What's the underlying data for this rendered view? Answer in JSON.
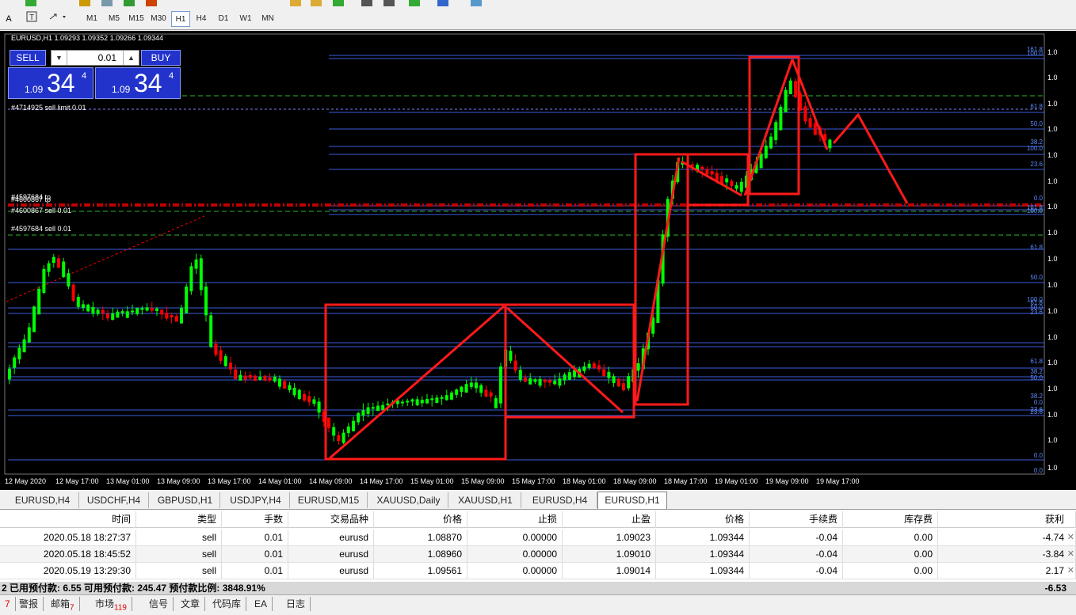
{
  "toolbar": {
    "timeframes": [
      "M1",
      "M5",
      "M15",
      "M30",
      "H1",
      "H4",
      "D1",
      "W1",
      "MN"
    ],
    "active_timeframe": "H1",
    "left_letter": "A"
  },
  "chart": {
    "header": "EURUSD,H1  1.09293 1.09352 1.09266 1.09344",
    "trade_panel": {
      "sell_label": "SELL",
      "buy_label": "BUY",
      "lot": "0.01",
      "sell_price_small": "1.09",
      "sell_price_big": "34",
      "sell_price_sup": "4",
      "buy_price_small": "1.09",
      "buy_price_big": "34",
      "buy_price_sup": "4"
    },
    "order_labels": [
      "#4714925 sell limit 0.01",
      "#4597684 tp",
      "#4600867 tp",
      "#4600867 sell 0.01",
      "#4597684 sell 0.01"
    ],
    "x_labels": [
      "12 May 2020",
      "12 May 17:00",
      "13 May 01:00",
      "13 May 09:00",
      "13 May 17:00",
      "14 May 01:00",
      "14 May 09:00",
      "14 May 17:00",
      "15 May 01:00",
      "15 May 09:00",
      "15 May 17:00",
      "18 May 01:00",
      "18 May 09:00",
      "18 May 17:00",
      "19 May 01:00",
      "19 May 09:00",
      "19 May 17:00"
    ],
    "right_label": "1.0",
    "fib_labels": [
      "161.8",
      "100.0",
      "61.8",
      "50.0",
      "38.2",
      "100.0",
      "23.6",
      "0.0",
      "161.8",
      "100.0",
      "61.8",
      "50.0",
      "100.0",
      "61.8",
      "50.0",
      "23.6",
      "61.8",
      "38.2",
      "50.0",
      "38.2",
      "0.0",
      "23.6",
      "23.6",
      "0.0",
      "0.0"
    ],
    "colors": {
      "background": "#000000",
      "bull": "#00ff00",
      "bear": "#ff0000",
      "annotation": "#ff1a1a",
      "fib_line": "#3b5bdb",
      "level_green": "#2db82d"
    }
  },
  "symbol_tabs": [
    "EURUSD,H4",
    "USDCHF,H4",
    "GBPUSD,H1",
    "USDJPY,H4",
    "EURUSD,M15",
    "XAUUSD,Daily",
    "XAUUSD,H1",
    "EURUSD,H4",
    "EURUSD,H1"
  ],
  "active_symbol_tab": "EURUSD,H1",
  "orders": {
    "columns": [
      "时间",
      "类型",
      "手数",
      "交易品种",
      "价格",
      "止损",
      "止盈",
      "价格",
      "手续费",
      "库存费",
      "获利"
    ],
    "rows": [
      [
        "2020.05.18 18:27:37",
        "sell",
        "0.01",
        "eurusd",
        "1.08870",
        "0.00000",
        "1.09023",
        "1.09344",
        "-0.04",
        "0.00",
        "-4.74"
      ],
      [
        "2020.05.18 18:45:52",
        "sell",
        "0.01",
        "eurusd",
        "1.08960",
        "0.00000",
        "1.09010",
        "1.09344",
        "-0.04",
        "0.00",
        "-3.84"
      ],
      [
        "2020.05.19 13:29:30",
        "sell",
        "0.01",
        "eurusd",
        "1.09561",
        "0.00000",
        "1.09014",
        "1.09344",
        "-0.04",
        "0.00",
        "2.17"
      ]
    ],
    "summary_left": "2  已用预付款: 6.55  可用预付款: 245.47  预付款比例: 3848.91%",
    "summary_right": "-6.53"
  },
  "bottom_tabs": [
    {
      "label": "7",
      "badge": ""
    },
    {
      "label": "警报",
      "badge": ""
    },
    {
      "label": "邮箱",
      "badge": "7"
    },
    {
      "label": "市场",
      "badge": "119"
    },
    {
      "label": "信号",
      "badge": ""
    },
    {
      "label": "文章",
      "badge": ""
    },
    {
      "label": "代码库",
      "badge": ""
    },
    {
      "label": "EA",
      "badge": ""
    },
    {
      "label": "日志",
      "badge": ""
    }
  ]
}
